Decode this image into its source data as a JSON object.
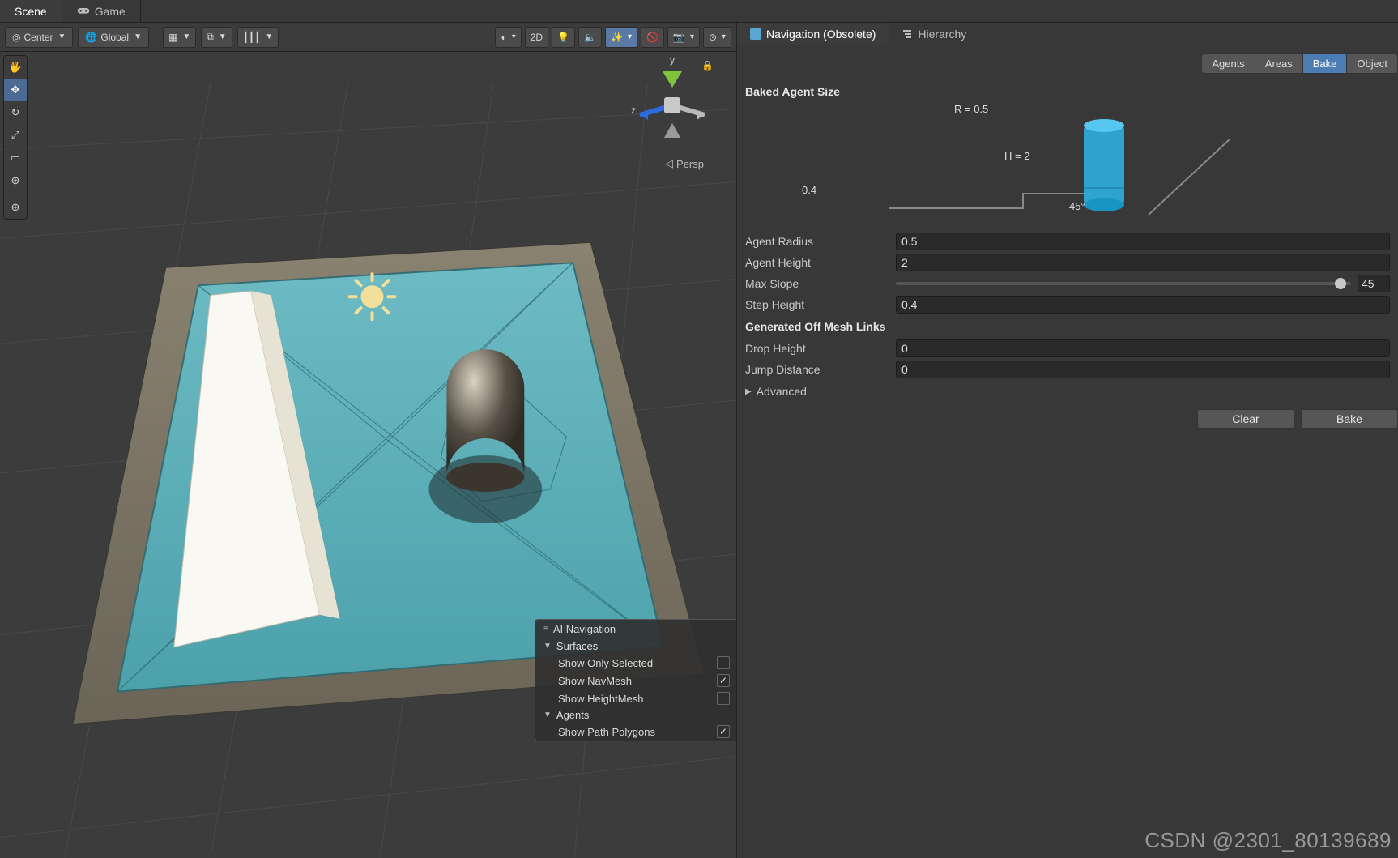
{
  "topTabs": {
    "scene": "Scene",
    "game": "Game"
  },
  "sceneToolbar": {
    "pivot": "Center",
    "handle": "Global",
    "btn2d": "2D",
    "persp": "Persp"
  },
  "gizmoAxes": {
    "y": "y",
    "z": "z"
  },
  "overlay": {
    "title": "AI Navigation",
    "groups": [
      {
        "label": "Surfaces",
        "items": [
          {
            "label": "Show Only Selected",
            "checked": false
          },
          {
            "label": "Show NavMesh",
            "checked": true
          },
          {
            "label": "Show HeightMesh",
            "checked": false
          }
        ]
      },
      {
        "label": "Agents",
        "items": [
          {
            "label": "Show Path Polygons",
            "checked": true
          }
        ]
      }
    ]
  },
  "inspTabs": {
    "nav": "Navigation (Obsolete)",
    "hier": "Hierarchy"
  },
  "modes": {
    "agents": "Agents",
    "areas": "Areas",
    "bake": "Bake",
    "object": "Object"
  },
  "bake": {
    "section": "Baked Agent Size",
    "rLabel": "R = 0.5",
    "hLabel": "H = 2",
    "stepDiag": "0.4",
    "slopeDiag": "45°",
    "agentRadiusLabel": "Agent Radius",
    "agentRadius": "0.5",
    "agentHeightLabel": "Agent Height",
    "agentHeight": "2",
    "maxSlopeLabel": "Max Slope",
    "maxSlope": "45",
    "stepHeightLabel": "Step Height",
    "stepHeight": "0.4",
    "offMeshSection": "Generated Off Mesh Links",
    "dropHeightLabel": "Drop Height",
    "dropHeight": "0",
    "jumpDistLabel": "Jump Distance",
    "jumpDist": "0",
    "advanced": "Advanced",
    "clearBtn": "Clear",
    "bakeBtn": "Bake"
  },
  "watermark": "CSDN @2301_80139689",
  "toolIcons": [
    "✥",
    "✛",
    "↻",
    "⤢",
    "▭",
    "⊕"
  ]
}
